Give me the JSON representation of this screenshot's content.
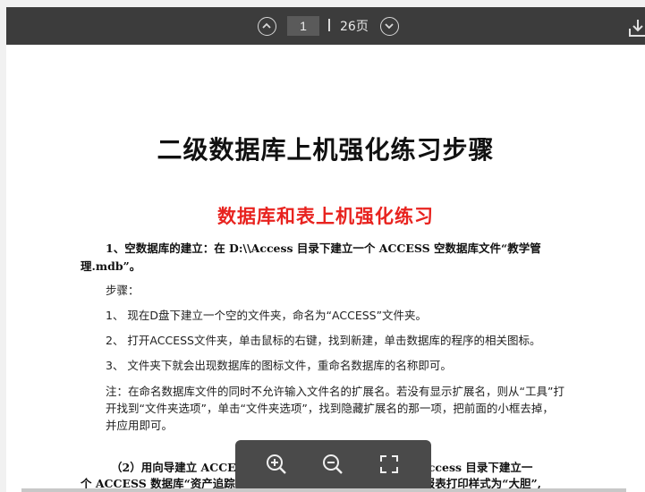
{
  "toolbar": {
    "current_page": "1",
    "total_pages": "26页"
  },
  "document": {
    "title": "二级数据库上机强化练习步骤",
    "subtitle": "数据库和表上机强化练习",
    "section1_line1": "1、空数据库的建立：在 D:\\\\Access 目录下建立一个 ACCESS 空数据库文件“教学管",
    "section1_line2": "理.mdb”。",
    "steps_label": "步骤：",
    "step1": "1、 现在D盘下建立一个空的文件夹，命名为“ACCESS”文件夹。",
    "step2": "2、 打开ACCESS文件夹，单击鼠标的右键，找到新建，单击数据库的程序的相关图标。",
    "step3": "3、 文件夹下就会出现数据库的图标文件，重命名数据库的名称即可。",
    "note_line1": "注：在命名数据库文件的同时不允许输入文件名的扩展名。若没有显示扩展名，则从“工具”打",
    "note_line2": "开找到“文件夹选项”，单击“文件夹选项”，找到隐藏扩展名的那一项，把前面的小框去掉，",
    "note_line3": "并应用即可。",
    "section2_line1": "（2）用向导建立 ACCESS 数据库；利用数据库向导 在 D:\\\\Access 目录下建立一",
    "section2_line2": "个 ACCESS 数据库“资产追踪.mdb”。要求显示样式设置为“标准”,报表打印样式为“大胆”,"
  },
  "colors": {
    "toolbar_bg": "#3c3c3c",
    "subtitle_red": "#e8231f",
    "zoombar_bg": "#4a4a4a"
  },
  "icons": [
    "chevron-up-icon",
    "chevron-down-icon",
    "download-icon",
    "zoom-in-icon",
    "zoom-out-icon",
    "fullscreen-icon"
  ]
}
